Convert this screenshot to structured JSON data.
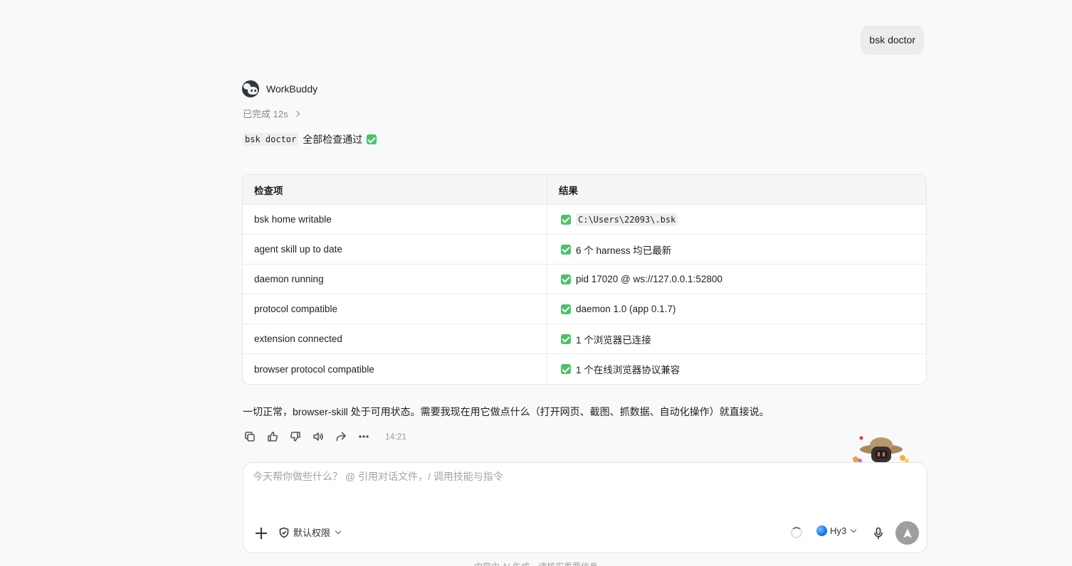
{
  "user_message": "bsk doctor",
  "assistant": {
    "name": "WorkBuddy",
    "status": "已完成 12s",
    "summary_code": "bsk doctor",
    "summary_text": "全部检查通过",
    "closing": "一切正常，browser-skill 处于可用状态。需要我现在用它做点什么（打开网页、截图、抓数据、自动化操作）就直接说。",
    "time": "14:21"
  },
  "table": {
    "headers": [
      "检查项",
      "结果"
    ],
    "rows": [
      {
        "item": "bsk home writable",
        "result": "C:\\Users\\22093\\.bsk",
        "code": true
      },
      {
        "item": "agent skill up to date",
        "result": "6 个 harness 均已最新",
        "code": false
      },
      {
        "item": "daemon running",
        "result": "pid 17020 @ ws://127.0.0.1:52800",
        "code": false
      },
      {
        "item": "protocol compatible",
        "result": "daemon 1.0 (app 0.1.7)",
        "code": false
      },
      {
        "item": "extension connected",
        "result": "1 个浏览器已连接",
        "code": false
      },
      {
        "item": "browser protocol compatible",
        "result": "1 个在线浏览器协议兼容",
        "code": false
      }
    ]
  },
  "composer": {
    "placeholder": "今天帮你做些什么？ @ 引用对话文件，/ 调用技能与指令",
    "permission_label": "默认权限",
    "model_label": "Hy3"
  },
  "disclaimer": "内容由 AI 生成，请核实重要信息",
  "icons": {
    "actions": [
      "copy-icon",
      "thumbs-up-icon",
      "thumbs-down-icon",
      "speaker-icon",
      "share-icon",
      "more-icon"
    ]
  }
}
